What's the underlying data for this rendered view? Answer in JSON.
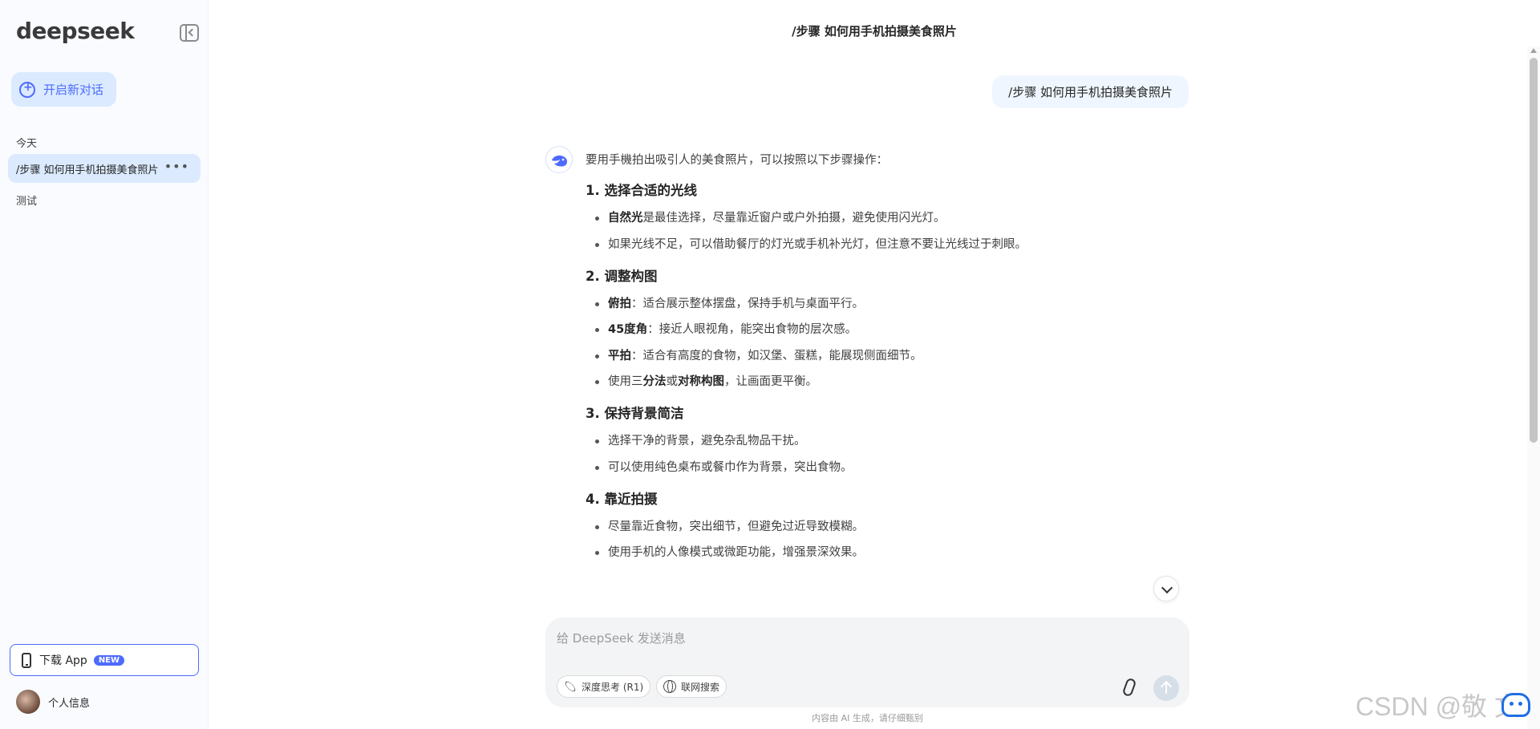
{
  "sidebar": {
    "logo": "deepseek",
    "new_chat_label": "开启新对话",
    "section_today": "今天",
    "history": [
      {
        "title": "/步骤 如何用手机拍摄美食照片",
        "active": true
      },
      {
        "title": "测试",
        "active": false
      }
    ],
    "download_label": "下载 App",
    "new_badge": "NEW",
    "profile_label": "个人信息"
  },
  "header": {
    "title": "/步骤 如何用手机拍摄美食照片"
  },
  "conversation": {
    "user_message": "/步骤 如何用手机拍摄美食照片",
    "intro": "要用手機拍出吸引人的美食照片，可以按照以下步骤操作：",
    "sections": [
      {
        "heading": "1. 选择合适的光线",
        "items": [
          {
            "bold": "自然光",
            "text": "是最佳选择，尽量靠近窗户或户外拍摄，避免使用闪光灯。"
          },
          {
            "bold": "",
            "text": "如果光线不足，可以借助餐厅的灯光或手机补光灯，但注意不要让光线过于刺眼。"
          }
        ]
      },
      {
        "heading": "2. 调整构图",
        "items": [
          {
            "bold": "俯拍",
            "text": "：适合展示整体摆盘，保持手机与桌面平行。"
          },
          {
            "bold": "45度角",
            "text": "：接近人眼视角，能突出食物的层次感。"
          },
          {
            "bold": "平拍",
            "text": "：适合有高度的食物，如汉堡、蛋糕，能展现侧面细节。"
          },
          {
            "pre": "使用三",
            "bold": "分法",
            "mid": "或",
            "bold2": "对称构图",
            "text": "，让画面更平衡。"
          }
        ]
      },
      {
        "heading": "3. 保持背景简洁",
        "items": [
          {
            "bold": "",
            "text": "选择干净的背景，避免杂乱物品干扰。"
          },
          {
            "bold": "",
            "text": "可以使用纯色桌布或餐巾作为背景，突出食物。"
          }
        ]
      },
      {
        "heading": "4. 靠近拍摄",
        "items": [
          {
            "bold": "",
            "text": "尽量靠近食物，突出细节，但避免过近导致模糊。"
          },
          {
            "bold": "",
            "text": "使用手机的人像模式或微距功能，增强景深效果。"
          }
        ]
      }
    ]
  },
  "input": {
    "placeholder": "给 DeepSeek 发送消息",
    "deep_think_label": "深度思考 (R1)",
    "web_search_label": "联网搜索"
  },
  "footer_note": "内容由 AI 生成，请仔细甄别",
  "watermark": "CSDN @敬 文",
  "colors": {
    "accent": "#4d6bfe",
    "sidebar_bg": "#f9fbff",
    "active_item": "#dbeafe"
  }
}
